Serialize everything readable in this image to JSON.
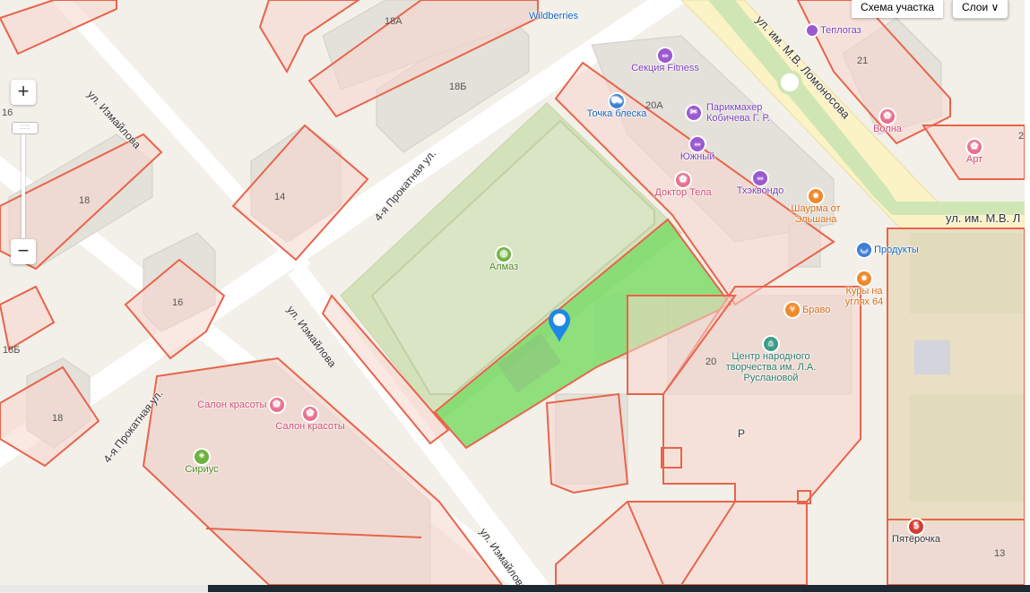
{
  "controls": {
    "zoom_in": "+",
    "zoom_out": "−",
    "zoom_handle": ":::::",
    "scheme_button": "Схема участка",
    "layers_button": "Слои",
    "layers_chevron": "∨"
  },
  "streets": {
    "izmailova_top": "ул. Измайлова",
    "prokatnaya_upper": "4-я Прокатная ул.",
    "izmailova_mid": "ул. Измайлова",
    "prokatnaya_lower": "4-я Прокатная ул.",
    "izmailova_bottom": "ул. Измайлова",
    "lomonosova_diag": "ул. им. М.В. Ломоносова",
    "lomonosova_right": "ул. им. М.В. Л"
  },
  "buildings": [
    "18А",
    "18Б",
    "14",
    "18",
    "16",
    "16",
    "18Б",
    "18",
    "20А",
    "21",
    "20",
    "13",
    "2"
  ],
  "pois": {
    "wildberries": "Wildberries",
    "teplogaz": "Теплогаз",
    "fitness": "Секция Fitness",
    "tochka": "Точка блеска",
    "parikmakher": "Парикмахер Кобичева Г. Р.",
    "yuzhny": "Южный",
    "doktor": "Доктор Тела",
    "taekwondo": "Тхэквондо",
    "volna": "Волна",
    "art": "Арт",
    "shaurma": "Шаурма от Эльшана",
    "produkty": "Продукты",
    "kury": "Куры на углях 64",
    "almaz": "Алмаз",
    "bravo": "Браво",
    "centr": "Центр народного творчества им. Л.А. Руслановой",
    "salon1": "Салон красоты",
    "salon2": "Салон красоты",
    "sirius": "Сириус",
    "pyaterochka": "Пятёрочка",
    "parking": "P"
  },
  "colors": {
    "parcel_stroke": "#e8644b",
    "parcel_fill": "#f6d5cc",
    "selected_parcel": "#7ddc6a",
    "stadium": "#d2dfb8",
    "pin": "#1e88e5"
  },
  "icons": {
    "fitness": "dumbbell-icon",
    "tochka": "car-wash-icon",
    "parikmakher": "scissors-icon",
    "yuzhny": "dumbbell-icon",
    "doktor": "lotus-icon",
    "taekwondo": "dumbbell-icon",
    "volna": "lotus-icon",
    "art": "lotus-icon",
    "shaurma": "food-icon",
    "produkty": "basket-icon",
    "kury": "food-icon",
    "almaz": "stadium-icon",
    "bravo": "restaurant-icon",
    "centr": "museum-icon",
    "salon": "lotus-icon",
    "sirius": "pharmacy-icon",
    "pyaterochka": "store-icon"
  }
}
